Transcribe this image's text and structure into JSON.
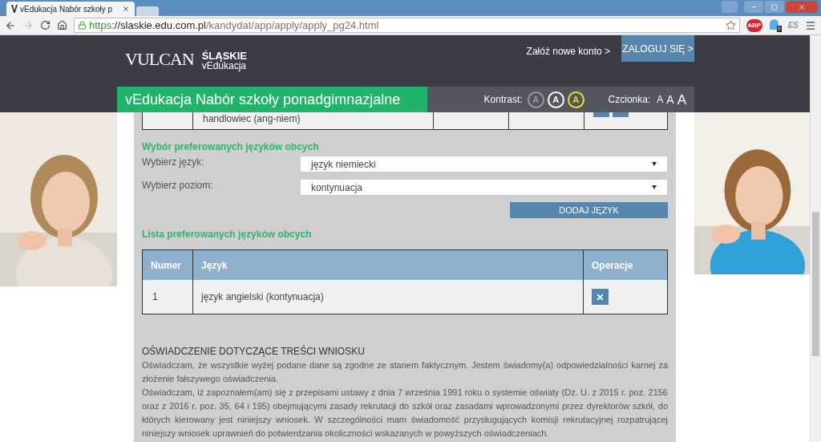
{
  "browser": {
    "tab_title": "vEdukacja Nabór szkoły p",
    "url": {
      "scheme": "https",
      "host": "://slaskie.edu.com.pl",
      "path": "/kandydat/app/apply/apply_pg24.html"
    },
    "extensions": [
      {
        "kind": "abp",
        "label": "ABP"
      },
      {
        "kind": "ghost",
        "label": "0"
      },
      {
        "kind": "es",
        "label": "ES"
      }
    ]
  },
  "header": {
    "logo": "VULCAN",
    "brand_top": "ŚLĄSKIE",
    "brand_bottom": "vEdukacja",
    "register_link": "Załóż nowe konto >",
    "login_button": "ZALOGUJ SIĘ >",
    "title": "vEdukacja Nabór szkoły ponadgimnazjalne",
    "contrast_label": "Kontrast:",
    "contrast_options": [
      {
        "label": "A",
        "color": "#9a9a9a"
      },
      {
        "label": "A",
        "color": "#ffffff"
      },
      {
        "label": "A",
        "color": "#e8e020"
      }
    ],
    "font_label": "Czcionka:",
    "font_sizes": [
      {
        "label": "A",
        "kind": "small"
      },
      {
        "label": "A",
        "kind": "medium"
      },
      {
        "label": "A",
        "kind": "large"
      }
    ]
  },
  "previous_table": {
    "row": {
      "column_2": "handlowiec (ang-niem)"
    }
  },
  "language_choice": {
    "heading": "Wybór preferowanych języków obcych",
    "fields": [
      {
        "label": "Wybierz język:",
        "value": "język niemiecki"
      },
      {
        "label": "Wybierz poziom:",
        "value": "kontynuacja"
      }
    ],
    "add_button": "DODAJ JĘZYK"
  },
  "language_list": {
    "heading": "Lista preferowanych języków obcych",
    "columns": [
      "Numer",
      "Język",
      "Operacje"
    ],
    "rows": [
      {
        "number": "1",
        "language": "język angielski (kontynuacja)"
      }
    ]
  },
  "statement": {
    "heading": "OŚWIADCZENIE DOTYCZĄCE TREŚCI WNIOSKU",
    "paragraphs": [
      "Oświadczam, że wszystkie wyżej podane dane są zgodne ze stanem faktycznym. Jestem świadomy(a) odpowiedzialności karnej za złożenie fałszywego oświadczenia.",
      "Oświadczam, iż zapoznałem(am) się z przepisami ustawy z dnia 7 września 1991 roku o systemie oświaty (Dz. U. z 2015 r. poz. 2156 oraz z 2016 r. poz. 35, 64 i 195) obejmującymi zasady rekrutacji do szkół oraz zasadami wprowadzonymi przez dyrektorów szkół, do których kierowany jest niniejszy wniosek. W szczególności mam świadomość przysługujących komisji rekrutacyjnej rozpatrującej niniejszy wniosek uprawnień do potwierdzania okoliczności wskazanych w powyższych oświadczeniach."
    ]
  }
}
